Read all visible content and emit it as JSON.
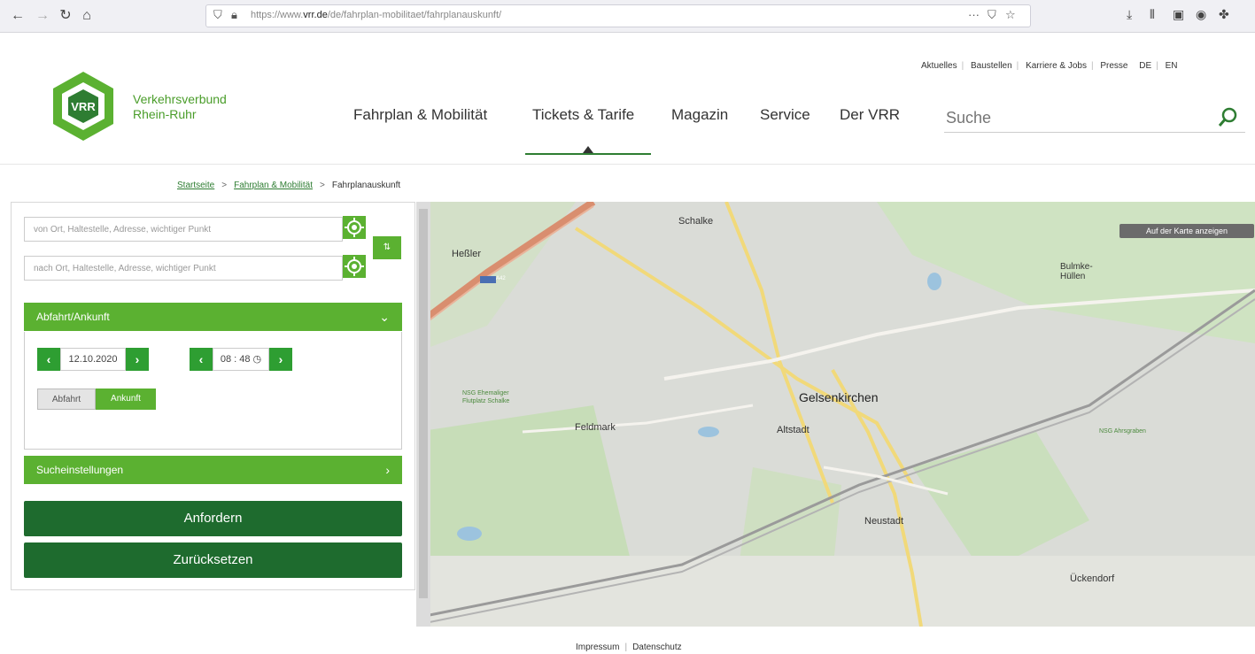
{
  "browser": {
    "url_plain": "https://www.",
    "url_domain": "vrr.de",
    "url_path": "/de/fahrplan-mobilitaet/fahrplanauskunft/"
  },
  "brand": {
    "logo_text": "VRR",
    "line1": "Verkehrsverbund",
    "line2": "Rhein-Ruhr",
    "color": "#4a9d2a"
  },
  "toplinks": [
    "Aktuelles",
    "Baustellen",
    "Karriere & Jobs",
    "Presse",
    "DE",
    "EN"
  ],
  "nav": {
    "items": [
      "Fahrplan & Mobilität",
      "Tickets & Tarife",
      "Magazin",
      "Service",
      "Der VRR"
    ],
    "search_placeholder": "Suche"
  },
  "breadcrumb": {
    "items": [
      "Startseite",
      "Fahrplan & Mobilität"
    ],
    "current": "Fahrplanauskunft"
  },
  "form": {
    "from_placeholder": "von Ort, Haltestelle, Adresse, wichtiger Punkt",
    "to_placeholder": "nach Ort, Haltestelle, Adresse, wichtiger Punkt",
    "swap_label": "⇅",
    "section1": "Abfahrt/Ankunft",
    "date": "12.10.2020",
    "time": "08 : 48",
    "toggle_departure": "Abfahrt",
    "toggle_arrival": "Ankunft",
    "section2": "Sucheinstellungen",
    "submit": "Anfordern",
    "reset": "Zurücksetzen"
  },
  "map": {
    "show_button": "Auf der Karte anzeigen",
    "labels": [
      "Schalke",
      "Heßler",
      "Bulmke-Hüllen",
      "Gelsenkirchen",
      "Feldmark",
      "Altstadt",
      "Neustadt",
      "Ückendorf"
    ],
    "park_labels": [
      "NSG Ehemaliger Flutplatz Schalke",
      "NSG Ahrsgraben"
    ],
    "highway": "A42"
  },
  "footer": [
    "Impressum",
    "Datenschutz"
  ],
  "colors": {
    "green": "#5bb131",
    "dark_green": "#1e6b2e",
    "accent": "#2e7d32"
  }
}
